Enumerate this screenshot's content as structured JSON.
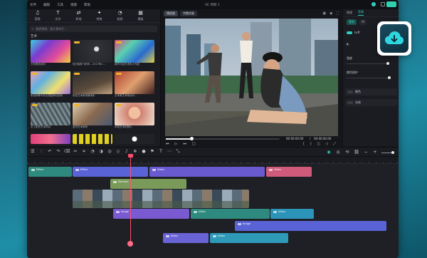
{
  "app": {
    "title": "VE 项目 1",
    "menu": [
      "文件",
      "编辑",
      "工具",
      "视图",
      "帮助"
    ]
  },
  "media": {
    "tabs": [
      {
        "label": "音频",
        "icon": "music-icon"
      },
      {
        "label": "文字",
        "icon": "text-icon"
      },
      {
        "label": "转场",
        "icon": "transition-icon"
      },
      {
        "label": "特效",
        "icon": "effects-icon"
      },
      {
        "label": "贴纸",
        "icon": "sticker-icon"
      },
      {
        "label": "模板",
        "icon": "template-icon"
      }
    ],
    "search_placeholder": "搜索视频、图片素材打...",
    "category": "艺术",
    "tiles": [
      {
        "label": "万花筒流动叭",
        "color": "#6a4cc7"
      },
      {
        "label": "彩灯旋转飞的叭…2017年1…",
        "color": "#3a3f48"
      },
      {
        "label": "城市马克艺术的人作品",
        "color": "#8b3a6b"
      },
      {
        "label": "彩色转移中彩无限旋转动态叭",
        "color": "#4a7aa8"
      },
      {
        "label": "彩色艺术家风格地叭",
        "color": "#2d2f36"
      },
      {
        "label": "艺术家艺术家女叭…",
        "color": "#7a2f2a"
      },
      {
        "label": "手工制作艺术项目",
        "color": "#5a6a6f"
      },
      {
        "label": "室内艺术家家",
        "color": "#6b5a4a"
      },
      {
        "label": "年轻艺术的照片",
        "color": "#b88a70"
      },
      {
        "label": "",
        "color": "#c8386b"
      },
      {
        "label": "",
        "color": "#d7c92a"
      },
      {
        "label": "",
        "color": "#222428"
      }
    ]
  },
  "player": {
    "tabs": [
      "播放器",
      "完整质量"
    ],
    "time_current": "00:00:00:00",
    "time_total": "00:00:00:00"
  },
  "props": {
    "tabs": [
      "视频",
      "音频"
    ],
    "subtabs": [
      "基础",
      "AI"
    ],
    "rows": [
      {
        "label": "Left"
      },
      {
        "label": "强度"
      },
      {
        "label": "颜色保护"
      },
      {
        "label": "颜色"
      },
      {
        "label": "光效"
      }
    ]
  },
  "timeline": {
    "clips": [
      {
        "label": "Effect",
        "color": "#2e8a7e"
      },
      {
        "label": "Effect",
        "color": "#5a63d6"
      },
      {
        "label": "Video",
        "color": "#6a5ad0"
      },
      {
        "label": "Video",
        "color": "#cf5a7a"
      },
      {
        "label": "Element",
        "color": "#7a9a5a"
      },
      {
        "label": "Image",
        "color": "#7a5ad0"
      },
      {
        "label": "Video",
        "color": "#2e8a7e"
      },
      {
        "label": "Video",
        "color": "#2b94b8"
      },
      {
        "label": "Image",
        "color": "#5a63d6"
      },
      {
        "label": "Video",
        "color": "#6a63d6"
      },
      {
        "label": "Video",
        "color": "#2e9ab8"
      }
    ]
  },
  "colors": {
    "accent": "#2fd0c1",
    "playhead": "#ff4d6d"
  },
  "download_badge": {
    "icon": "cloud-download-icon"
  }
}
